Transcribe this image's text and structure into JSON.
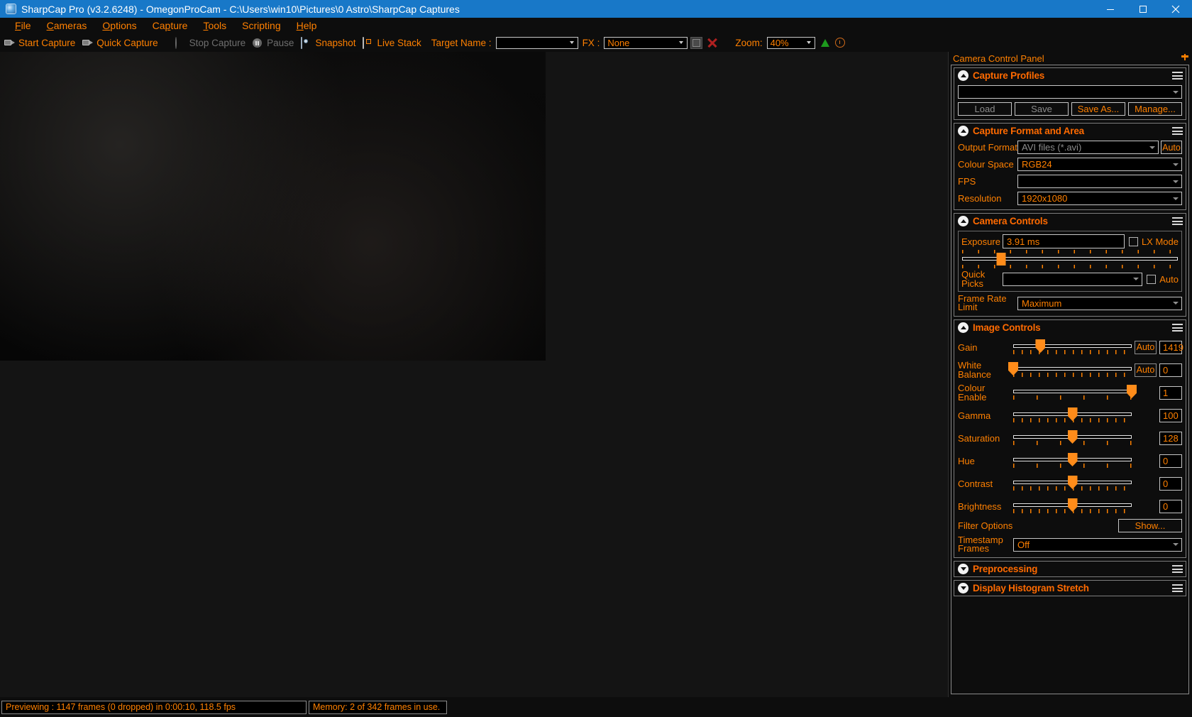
{
  "window": {
    "title": "SharpCap Pro (v3.2.6248) - OmegonProCam - C:\\Users\\win10\\Pictures\\0 Astro\\SharpCap Captures",
    "icon": "sharpcap-logo",
    "minimize": "─",
    "maximize": "❐",
    "close": "✕"
  },
  "menu": {
    "items": [
      {
        "label": "File",
        "accel": "F"
      },
      {
        "label": "Cameras",
        "accel": "C"
      },
      {
        "label": "Options",
        "accel": "O"
      },
      {
        "label": "Capture",
        "accel": "p"
      },
      {
        "label": "Tools",
        "accel": "T"
      },
      {
        "label": "Scripting",
        "accel": ""
      },
      {
        "label": "Help",
        "accel": "H"
      }
    ]
  },
  "toolbar": {
    "start_capture": "Start Capture",
    "quick_capture": "Quick Capture",
    "stop_capture": "Stop Capture",
    "pause": "Pause",
    "snapshot": "Snapshot",
    "live_stack": "Live Stack",
    "target_name_label": "Target Name :",
    "target_name_value": "",
    "fx_label": "FX :",
    "fx_value": "None",
    "zoom_label": "Zoom:",
    "zoom_value": "40%"
  },
  "panel": {
    "title": "Camera Control Panel",
    "capture_profiles": {
      "title": "Capture Profiles",
      "selected": "",
      "load": "Load",
      "save": "Save",
      "save_as": "Save As...",
      "manage": "Manage..."
    },
    "capture_format": {
      "title": "Capture Format and Area",
      "output_format_label": "Output Format",
      "output_format_value": "AVI files (*.avi)",
      "auto_button": "Auto",
      "colour_space_label": "Colour Space",
      "colour_space_value": "RGB24",
      "fps_label": "FPS",
      "fps_value": "",
      "resolution_label": "Resolution",
      "resolution_value": "1920x1080"
    },
    "camera_controls": {
      "title": "Camera Controls",
      "exposure_label": "Exposure",
      "exposure_value": "3.91 ms",
      "lx_mode_label": "LX Mode",
      "lx_mode_checked": false,
      "exposure_slider_percent": 18,
      "quick_picks_label": "Quick Picks",
      "quick_picks_value": "",
      "quick_picks_auto_label": "Auto",
      "quick_picks_auto_checked": false,
      "frame_rate_label": "Frame Rate Limit",
      "frame_rate_value": "Maximum"
    },
    "image_controls": {
      "title": "Image Controls",
      "auto_label": "Auto",
      "sliders": [
        {
          "label": "Gain",
          "value": "1419",
          "percent": 23,
          "has_auto": true,
          "tick": "fine"
        },
        {
          "label": "White Balance",
          "value": "0",
          "percent": 0,
          "has_auto": true,
          "tick": "fine"
        },
        {
          "label": "Colour Enable",
          "value": "1",
          "percent": 100,
          "has_auto": false,
          "tick": "wide"
        },
        {
          "label": "Gamma",
          "value": "100",
          "percent": 50,
          "has_auto": false,
          "tick": "fine"
        },
        {
          "label": "Saturation",
          "value": "128",
          "percent": 50,
          "has_auto": false,
          "tick": "wide"
        },
        {
          "label": "Hue",
          "value": "0",
          "percent": 50,
          "has_auto": false,
          "tick": "wide"
        },
        {
          "label": "Contrast",
          "value": "0",
          "percent": 50,
          "has_auto": false,
          "tick": "fine"
        },
        {
          "label": "Brightness",
          "value": "0",
          "percent": 50,
          "has_auto": false,
          "tick": "fine"
        }
      ],
      "filter_options_label": "Filter Options",
      "filter_options_button": "Show...",
      "timestamp_label": "Timestamp Frames",
      "timestamp_value": "Off"
    },
    "preprocessing": {
      "title": "Preprocessing"
    },
    "display_histogram": {
      "title": "Display Histogram Stretch"
    }
  },
  "status": {
    "preview": "Previewing : 1147 frames (0 dropped) in 0:00:10, 118.5 fps",
    "memory": "Memory: 2 of 342 frames in use."
  },
  "colors": {
    "accent": "#ff8000",
    "title_bar": "#1878c8",
    "disabled": "#8c8c8c",
    "slider": "#ff8c1a"
  }
}
